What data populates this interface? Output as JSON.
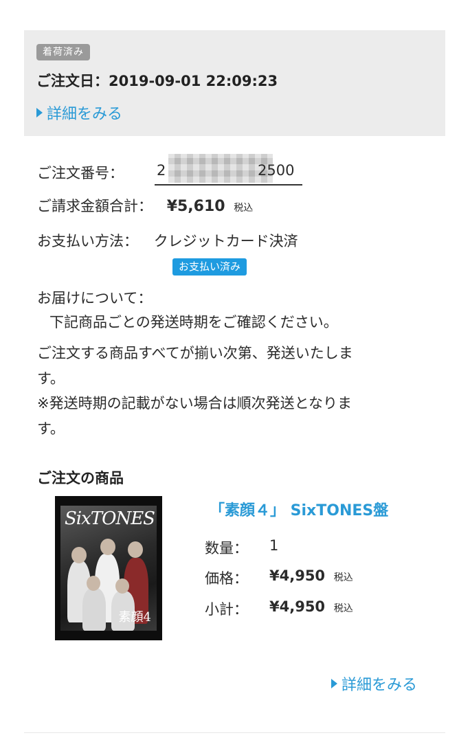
{
  "header": {
    "status_badge": "着荷済み",
    "order_date": "ご注文日：2019-09-01 22:09:23",
    "details_link": "詳細をみる"
  },
  "order": {
    "number_label": "ご注文番号：",
    "number_start": "2",
    "number_end": "2500",
    "total_label": "ご請求金額合計：",
    "total_value": "¥5,610",
    "tax_label": "税込",
    "payment_label": "お支払い方法：",
    "payment_value": "クレジットカード決済",
    "paid_badge": "お支払い済み"
  },
  "delivery": {
    "heading": "お届けについて：",
    "line1": "下記商品ごとの発送時期をご確認ください。",
    "line2a": "ご注文する商品すべてが揃い次第、発送いたしま",
    "line2b": "す。",
    "line3a": "※発送時期の記載がない場合は順次発送となりま",
    "line3b": "す。"
  },
  "products_section": {
    "title": "ご注文の商品",
    "items": [
      {
        "title": "「素顔４」 SixTONES盤",
        "cover_text": "SixTONES",
        "cover_tag": "素顔4",
        "qty_label": "数量：",
        "qty_value": "1",
        "price_label": "価格：",
        "price_value": "¥4,950",
        "subtotal_label": "小計：",
        "subtotal_value": "¥4,950",
        "tax_label": "税込"
      }
    ],
    "details_link": "詳細をみる"
  },
  "colors": {
    "accent": "#2a9ad6",
    "paid_badge": "#1e9be0",
    "status_badge": "#9a9a9a",
    "header_bg": "#ececec"
  }
}
